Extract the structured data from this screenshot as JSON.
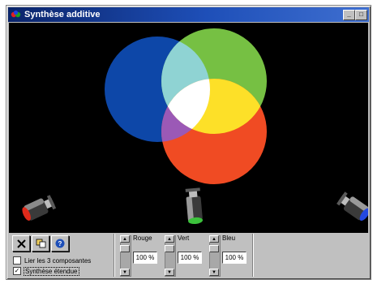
{
  "window": {
    "title": "Synthèse additive"
  },
  "colors": {
    "blue": "#0d47a8",
    "green": "#76c043",
    "red": "#f04b23",
    "cyan": "#8fd3d3",
    "magenta": "#9b59b6",
    "yellow": "#fde028",
    "white": "#ffffff"
  },
  "toolbar": {
    "buttons": [
      {
        "name": "close",
        "icon": "x-icon"
      },
      {
        "name": "copy",
        "icon": "copy-icon"
      },
      {
        "name": "help",
        "icon": "help-icon"
      }
    ]
  },
  "options": {
    "link": {
      "label": "Lier les 3 composantes",
      "checked": false
    },
    "extended": {
      "label": "Synthèse étendue",
      "checked": true
    }
  },
  "sliders": [
    {
      "label": "Rouge",
      "value": "100 %"
    },
    {
      "label": "Vert",
      "value": "100 %"
    },
    {
      "label": "Bleu",
      "value": "100 %"
    }
  ]
}
